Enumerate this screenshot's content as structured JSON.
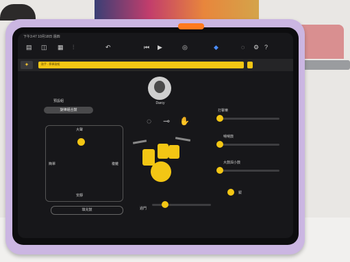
{
  "toolbar": {
    "status_text": "下午3:47  10月18日 週四",
    "icons": [
      "document-icon",
      "tracks-view-icon",
      "mixer-icon",
      "settings-slider-icon",
      "undo-icon",
      "rewind-icon",
      "play-icon",
      "metronome-icon",
      "smart-controls-icon",
      "loop-icon",
      "settings-icon",
      "help-icon"
    ]
  },
  "region": {
    "label": "鼓手 - 節奏鼓組"
  },
  "drummer": {
    "name": "Darcy"
  },
  "left_panel": {
    "preset_title": "預設組",
    "preset_value": "旋律組合鼓",
    "pad_top": "大聲",
    "pad_bottom": "安靜",
    "pad_left": "簡單",
    "pad_right": "複雜",
    "bottom_button": "填充鼓"
  },
  "right_panel": {
    "sliders": [
      {
        "label": "打擊樂",
        "level": 0.1
      },
      {
        "label": "嗵嗵鼓",
        "level": 0.1
      },
      {
        "label": "大鼓與小鼓",
        "level": 0.1
      },
      {
        "label": "鈸",
        "level": 0.1
      }
    ]
  },
  "bottom": {
    "fill_label": "過門",
    "fill_level": 0.3
  },
  "colors": {
    "accent": "#f3c614",
    "case": "#cbb6e2",
    "clip": "#ff7a1f"
  }
}
